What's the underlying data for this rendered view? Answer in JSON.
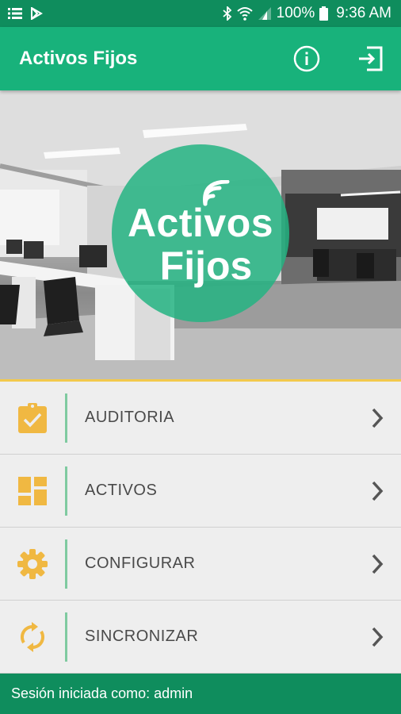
{
  "status_bar": {
    "battery": "100%",
    "time": "9:36 AM"
  },
  "app_bar": {
    "title": "Activos Fijos"
  },
  "logo": {
    "line1": "Activos",
    "line2": "Fijos"
  },
  "menu": {
    "items": [
      {
        "label": "AUDITORIA",
        "icon": "clipboard-check-icon"
      },
      {
        "label": "ACTIVOS",
        "icon": "dashboard-grid-icon"
      },
      {
        "label": "CONFIGURAR",
        "icon": "gear-icon"
      },
      {
        "label": "SINCRONIZAR",
        "icon": "sync-icon"
      }
    ]
  },
  "footer": {
    "session_text": "Sesión iniciada como: admin"
  },
  "colors": {
    "status_bar": "#0f8d5d",
    "app_bar": "#18b27b",
    "accent_icon": "#f0b842",
    "footer": "#0f8d5d"
  }
}
